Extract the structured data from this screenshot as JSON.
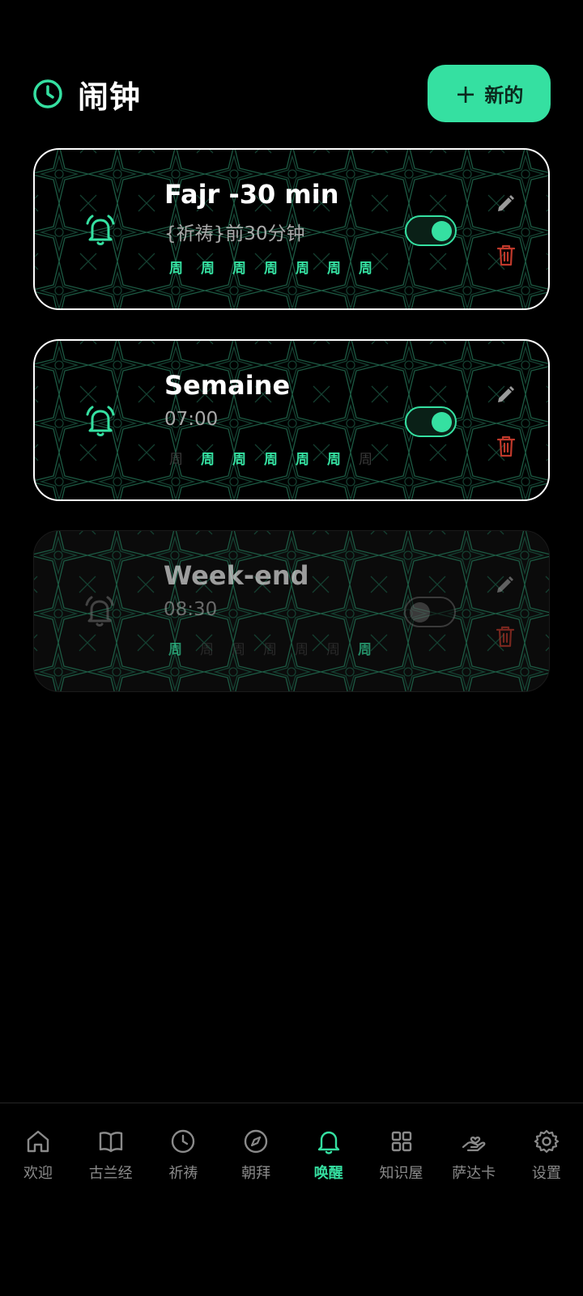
{
  "header": {
    "title": "闹钟",
    "new_button_label": "新的"
  },
  "colors": {
    "accent": "#35e0a1",
    "delete": "#c0392b",
    "muted": "#8a8a8a"
  },
  "alarms": [
    {
      "title": "Fajr -30 min",
      "subtitle": "{祈祷}前30分钟",
      "enabled": true,
      "days": [
        {
          "label": "周",
          "active": true
        },
        {
          "label": "周",
          "active": true
        },
        {
          "label": "周",
          "active": true
        },
        {
          "label": "周",
          "active": true
        },
        {
          "label": "周",
          "active": true
        },
        {
          "label": "周",
          "active": true
        },
        {
          "label": "周",
          "active": true
        }
      ]
    },
    {
      "title": "Semaine",
      "subtitle": "07:00",
      "enabled": true,
      "days": [
        {
          "label": "周",
          "active": false
        },
        {
          "label": "周",
          "active": true
        },
        {
          "label": "周",
          "active": true
        },
        {
          "label": "周",
          "active": true
        },
        {
          "label": "周",
          "active": true
        },
        {
          "label": "周",
          "active": true
        },
        {
          "label": "周",
          "active": false
        }
      ]
    },
    {
      "title": "Week-end",
      "subtitle": "08:30",
      "enabled": false,
      "days": [
        {
          "label": "周",
          "active": true
        },
        {
          "label": "周",
          "active": false
        },
        {
          "label": "周",
          "active": false
        },
        {
          "label": "周",
          "active": false
        },
        {
          "label": "周",
          "active": false
        },
        {
          "label": "周",
          "active": false
        },
        {
          "label": "周",
          "active": true
        }
      ]
    }
  ],
  "nav": {
    "items": [
      {
        "label": "欢迎",
        "icon": "home-icon",
        "active": false
      },
      {
        "label": "古兰经",
        "icon": "book-icon",
        "active": false
      },
      {
        "label": "祈祷",
        "icon": "clock-icon",
        "active": false
      },
      {
        "label": "朝拜",
        "icon": "compass-icon",
        "active": false
      },
      {
        "label": "唤醒",
        "icon": "bell-icon",
        "active": true
      },
      {
        "label": "知识屋",
        "icon": "grid-icon",
        "active": false
      },
      {
        "label": "萨达卡",
        "icon": "hand-heart-icon",
        "active": false
      },
      {
        "label": "设置",
        "icon": "gear-icon",
        "active": false
      }
    ]
  }
}
